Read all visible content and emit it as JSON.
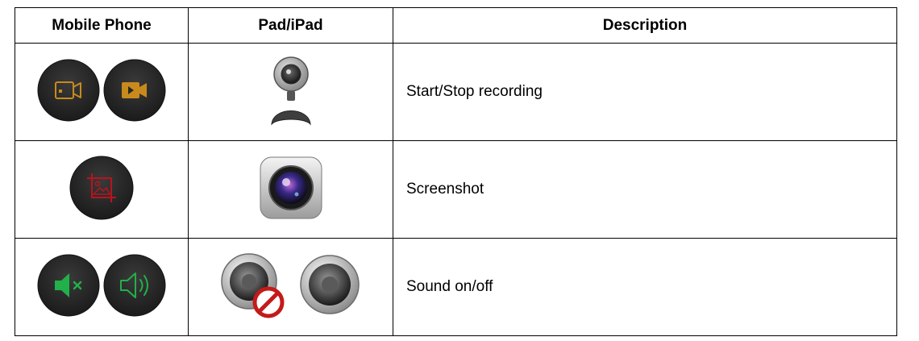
{
  "table": {
    "headers": [
      "Mobile Phone",
      "Pad/iPad",
      "Description"
    ],
    "rows": [
      {
        "description": "Start/Stop recording",
        "phone_icons": [
          "video-camera-outline-icon",
          "video-camera-filled-icon"
        ],
        "pad_icons": [
          "webcam-icon"
        ]
      },
      {
        "description": "Screenshot",
        "phone_icons": [
          "crop-image-icon"
        ],
        "pad_icons": [
          "camera-lens-icon"
        ]
      },
      {
        "description": "Sound on/off",
        "phone_icons": [
          "speaker-muted-icon",
          "speaker-on-icon"
        ],
        "pad_icons": [
          "speaker-muted-icon",
          "speaker-icon"
        ]
      }
    ]
  },
  "colors": {
    "button_dark": "#272727",
    "record_orange": "#c88a1c",
    "screenshot_red": "#b8141e",
    "sound_green": "#21b04a"
  }
}
